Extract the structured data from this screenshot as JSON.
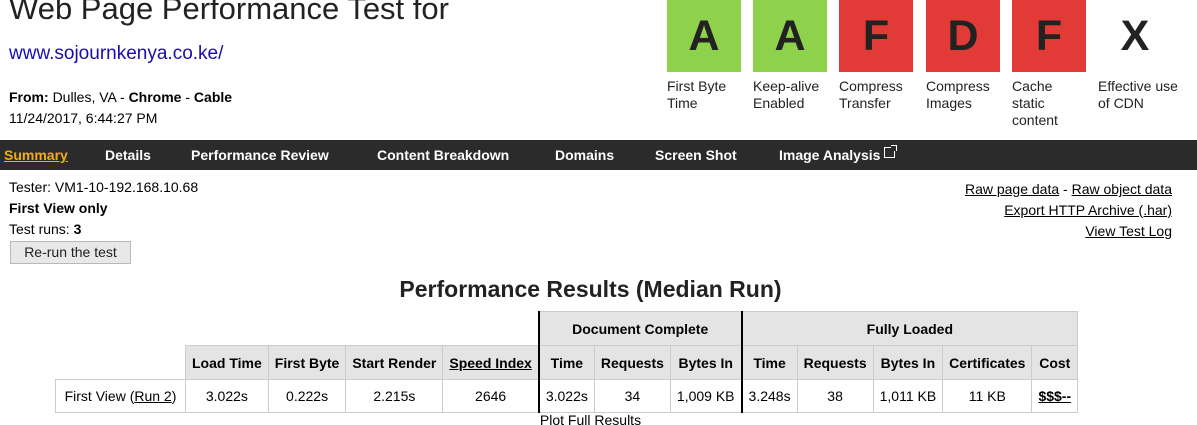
{
  "header": {
    "title": "Web Page Performance Test for",
    "site": "www.sojournkenya.co.ke/",
    "from_label": "From:",
    "location": "Dulles, VA",
    "browser": "Chrome",
    "connection": "Cable",
    "separator": "-",
    "datetime": "11/24/2017, 6:44:27 PM"
  },
  "grades": [
    {
      "letter": "A",
      "label": "First Byte Time",
      "color": "#8ed14b"
    },
    {
      "letter": "A",
      "label": "Keep-alive Enabled",
      "color": "#8ed14b"
    },
    {
      "letter": "F",
      "label": "Compress Transfer",
      "color": "#e23a36"
    },
    {
      "letter": "D",
      "label": "Compress Images",
      "color": "#e23a36"
    },
    {
      "letter": "F",
      "label": "Cache static content",
      "color": "#e23a36"
    },
    {
      "letter": "X",
      "label": "Effective use of CDN",
      "color": "#ffffff"
    }
  ],
  "nav": {
    "items": [
      "Summary",
      "Details",
      "Performance Review",
      "Content Breakdown",
      "Domains",
      "Screen Shot",
      "Image Analysis"
    ],
    "active": "Summary"
  },
  "test_info": {
    "tester": "Tester: VM1-10-192.168.10.68",
    "view_mode": "First View only",
    "runs_label": "Test runs:",
    "runs_value": "3",
    "rerun_button": "Re-run the test"
  },
  "links": {
    "raw_page_data": "Raw page data",
    "dash": "-",
    "raw_object_data": "Raw object data",
    "export_har": "Export HTTP Archive (.har)",
    "view_log": "View Test Log"
  },
  "results": {
    "heading": "Performance Results (Median Run)",
    "group_document": "Document Complete",
    "group_fully": "Fully Loaded",
    "columns": [
      "Load Time",
      "First Byte",
      "Start Render",
      "Speed Index",
      "Time",
      "Requests",
      "Bytes In",
      "Time",
      "Requests",
      "Bytes In",
      "Certificates",
      "Cost"
    ],
    "row": {
      "label_prefix": "First View (",
      "run_link": "Run 2",
      "label_suffix": ")",
      "values": [
        "3.022s",
        "0.222s",
        "2.215s",
        "2646",
        "3.022s",
        "34",
        "1,009 KB",
        "3.248s",
        "38",
        "1,011 KB",
        "11 KB",
        "$$$--"
      ]
    },
    "plot_link": "Plot Full Results"
  },
  "accent": {
    "nav_bg": "#2b2b2b",
    "nav_active": "#f2ab1c",
    "link": "#1a0dab"
  }
}
